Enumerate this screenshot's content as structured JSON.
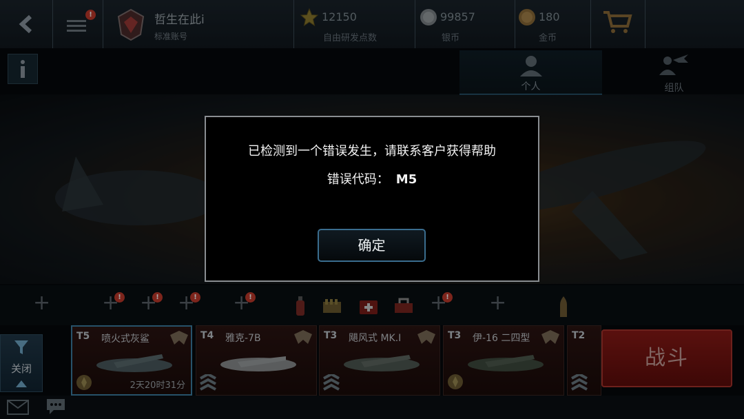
{
  "topbar": {
    "player_name": "哲生在此i",
    "account_type": "标准账号",
    "menu_badge": "!",
    "currencies": [
      {
        "icon": "star-icon",
        "value": "12150",
        "label": "自由研发点数"
      },
      {
        "icon": "silver-coin-icon",
        "value": "99857",
        "label": "银币"
      },
      {
        "icon": "gold-coin-icon",
        "value": "180",
        "label": "金币"
      }
    ]
  },
  "tabs": [
    {
      "label": "个人",
      "icon": "person-icon",
      "active": true
    },
    {
      "label": "组队",
      "icon": "squad-icon",
      "active": false
    }
  ],
  "slots": {
    "badge": "!"
  },
  "planes": [
    {
      "tier": "T5",
      "name": "喷火式灰鲨",
      "timer": "2天20时31分",
      "selected": true
    },
    {
      "tier": "T4",
      "name": "雅克-7B",
      "timer": "",
      "selected": false
    },
    {
      "tier": "T3",
      "name": "飓风式 MK.I",
      "timer": "",
      "selected": false
    },
    {
      "tier": "T3",
      "name": "伊-16 二四型",
      "timer": "",
      "selected": false
    },
    {
      "tier": "T2",
      "name": "",
      "timer": "",
      "selected": false
    }
  ],
  "filter": {
    "label": "关闭"
  },
  "battle": {
    "label": "战斗"
  },
  "dialog": {
    "message": "已检测到一个错误发生，请联系客户获得帮助",
    "code_label": "错误代码：",
    "code_value": "M5",
    "confirm_label": "确定"
  },
  "colors": {
    "accent": "#3a6d8e",
    "battle": "#8a1a16",
    "badge": "#c0392b"
  }
}
